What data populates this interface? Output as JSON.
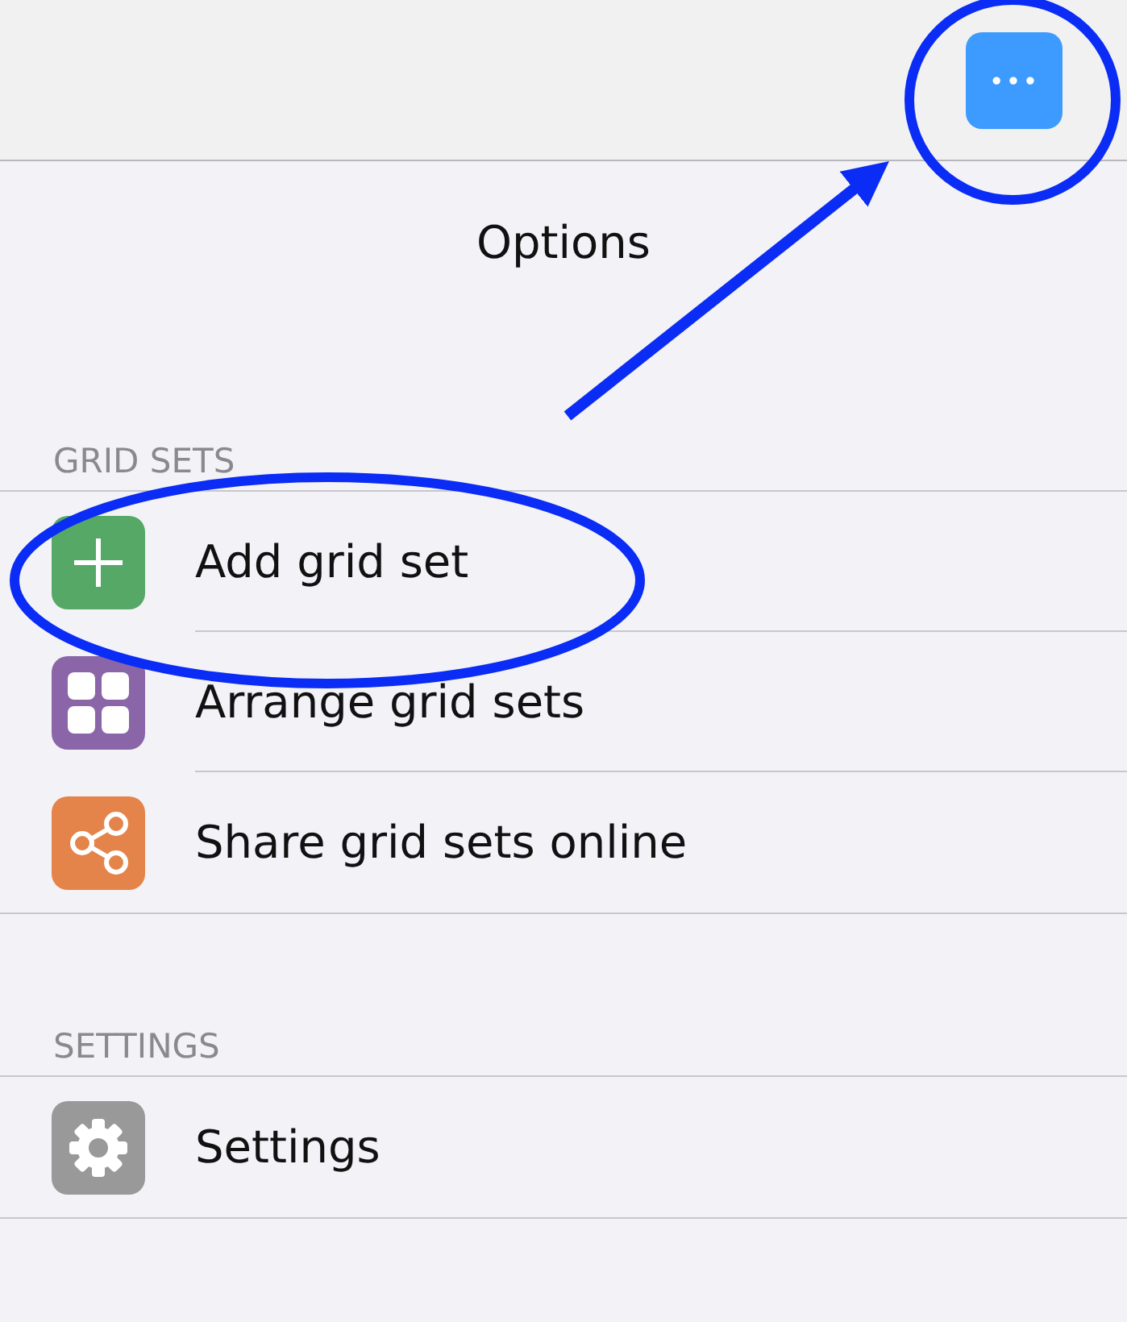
{
  "toolbar": {
    "more_button": "•••"
  },
  "title": "Options",
  "sections": [
    {
      "header": "GRID SETS",
      "items": [
        {
          "label": "Add grid set",
          "kind": "plus",
          "color": "#55a865"
        },
        {
          "label": "Arrange grid sets",
          "kind": "grid",
          "color": "#8a66a8"
        },
        {
          "label": "Share grid sets online",
          "kind": "share",
          "color": "#e5844a"
        }
      ]
    },
    {
      "header": "SETTINGS",
      "items": [
        {
          "label": "Settings",
          "kind": "gear",
          "color": "#999999"
        }
      ]
    }
  ]
}
